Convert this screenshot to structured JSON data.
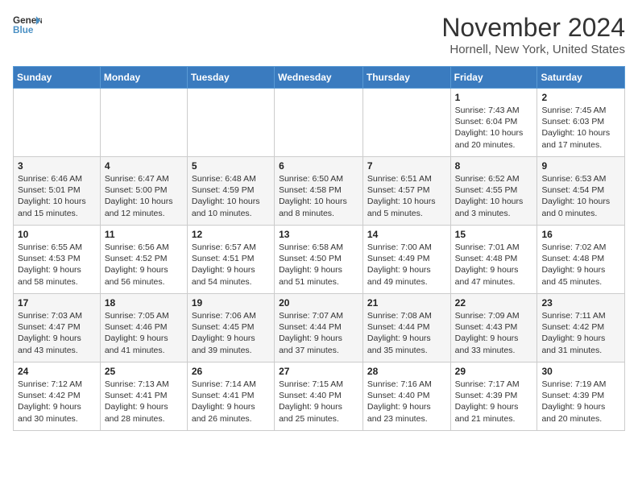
{
  "header": {
    "logo_line1": "General",
    "logo_line2": "Blue",
    "title": "November 2024",
    "subtitle": "Hornell, New York, United States"
  },
  "weekdays": [
    "Sunday",
    "Monday",
    "Tuesday",
    "Wednesday",
    "Thursday",
    "Friday",
    "Saturday"
  ],
  "weeks": [
    [
      {
        "day": "",
        "info": ""
      },
      {
        "day": "",
        "info": ""
      },
      {
        "day": "",
        "info": ""
      },
      {
        "day": "",
        "info": ""
      },
      {
        "day": "",
        "info": ""
      },
      {
        "day": "1",
        "info": "Sunrise: 7:43 AM\nSunset: 6:04 PM\nDaylight: 10 hours and 20 minutes."
      },
      {
        "day": "2",
        "info": "Sunrise: 7:45 AM\nSunset: 6:03 PM\nDaylight: 10 hours and 17 minutes."
      }
    ],
    [
      {
        "day": "3",
        "info": "Sunrise: 6:46 AM\nSunset: 5:01 PM\nDaylight: 10 hours and 15 minutes."
      },
      {
        "day": "4",
        "info": "Sunrise: 6:47 AM\nSunset: 5:00 PM\nDaylight: 10 hours and 12 minutes."
      },
      {
        "day": "5",
        "info": "Sunrise: 6:48 AM\nSunset: 4:59 PM\nDaylight: 10 hours and 10 minutes."
      },
      {
        "day": "6",
        "info": "Sunrise: 6:50 AM\nSunset: 4:58 PM\nDaylight: 10 hours and 8 minutes."
      },
      {
        "day": "7",
        "info": "Sunrise: 6:51 AM\nSunset: 4:57 PM\nDaylight: 10 hours and 5 minutes."
      },
      {
        "day": "8",
        "info": "Sunrise: 6:52 AM\nSunset: 4:55 PM\nDaylight: 10 hours and 3 minutes."
      },
      {
        "day": "9",
        "info": "Sunrise: 6:53 AM\nSunset: 4:54 PM\nDaylight: 10 hours and 0 minutes."
      }
    ],
    [
      {
        "day": "10",
        "info": "Sunrise: 6:55 AM\nSunset: 4:53 PM\nDaylight: 9 hours and 58 minutes."
      },
      {
        "day": "11",
        "info": "Sunrise: 6:56 AM\nSunset: 4:52 PM\nDaylight: 9 hours and 56 minutes."
      },
      {
        "day": "12",
        "info": "Sunrise: 6:57 AM\nSunset: 4:51 PM\nDaylight: 9 hours and 54 minutes."
      },
      {
        "day": "13",
        "info": "Sunrise: 6:58 AM\nSunset: 4:50 PM\nDaylight: 9 hours and 51 minutes."
      },
      {
        "day": "14",
        "info": "Sunrise: 7:00 AM\nSunset: 4:49 PM\nDaylight: 9 hours and 49 minutes."
      },
      {
        "day": "15",
        "info": "Sunrise: 7:01 AM\nSunset: 4:48 PM\nDaylight: 9 hours and 47 minutes."
      },
      {
        "day": "16",
        "info": "Sunrise: 7:02 AM\nSunset: 4:48 PM\nDaylight: 9 hours and 45 minutes."
      }
    ],
    [
      {
        "day": "17",
        "info": "Sunrise: 7:03 AM\nSunset: 4:47 PM\nDaylight: 9 hours and 43 minutes."
      },
      {
        "day": "18",
        "info": "Sunrise: 7:05 AM\nSunset: 4:46 PM\nDaylight: 9 hours and 41 minutes."
      },
      {
        "day": "19",
        "info": "Sunrise: 7:06 AM\nSunset: 4:45 PM\nDaylight: 9 hours and 39 minutes."
      },
      {
        "day": "20",
        "info": "Sunrise: 7:07 AM\nSunset: 4:44 PM\nDaylight: 9 hours and 37 minutes."
      },
      {
        "day": "21",
        "info": "Sunrise: 7:08 AM\nSunset: 4:44 PM\nDaylight: 9 hours and 35 minutes."
      },
      {
        "day": "22",
        "info": "Sunrise: 7:09 AM\nSunset: 4:43 PM\nDaylight: 9 hours and 33 minutes."
      },
      {
        "day": "23",
        "info": "Sunrise: 7:11 AM\nSunset: 4:42 PM\nDaylight: 9 hours and 31 minutes."
      }
    ],
    [
      {
        "day": "24",
        "info": "Sunrise: 7:12 AM\nSunset: 4:42 PM\nDaylight: 9 hours and 30 minutes."
      },
      {
        "day": "25",
        "info": "Sunrise: 7:13 AM\nSunset: 4:41 PM\nDaylight: 9 hours and 28 minutes."
      },
      {
        "day": "26",
        "info": "Sunrise: 7:14 AM\nSunset: 4:41 PM\nDaylight: 9 hours and 26 minutes."
      },
      {
        "day": "27",
        "info": "Sunrise: 7:15 AM\nSunset: 4:40 PM\nDaylight: 9 hours and 25 minutes."
      },
      {
        "day": "28",
        "info": "Sunrise: 7:16 AM\nSunset: 4:40 PM\nDaylight: 9 hours and 23 minutes."
      },
      {
        "day": "29",
        "info": "Sunrise: 7:17 AM\nSunset: 4:39 PM\nDaylight: 9 hours and 21 minutes."
      },
      {
        "day": "30",
        "info": "Sunrise: 7:19 AM\nSunset: 4:39 PM\nDaylight: 9 hours and 20 minutes."
      }
    ]
  ]
}
